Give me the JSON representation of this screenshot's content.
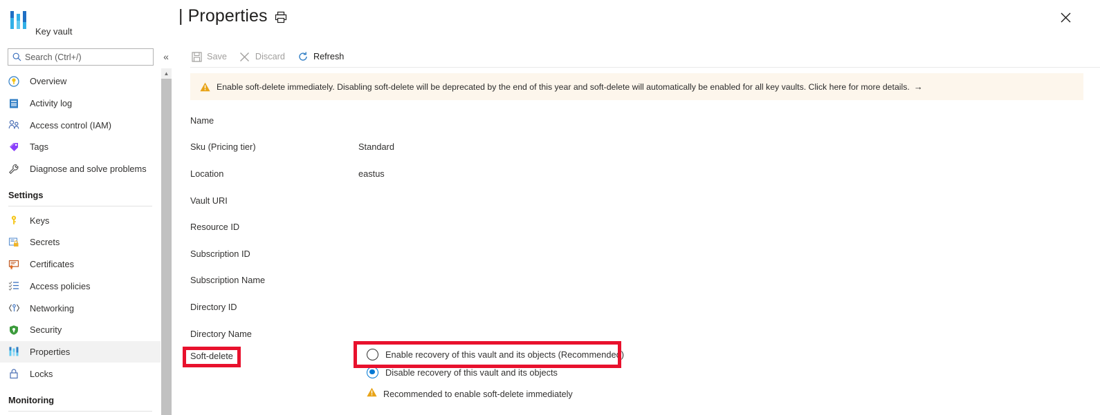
{
  "sidebar": {
    "resource_type": "Key vault",
    "logo_icon": "key-vault-icon",
    "search": {
      "placeholder": "Search (Ctrl+/)",
      "value": "",
      "icon": "search-icon"
    },
    "collapse_icon": "double-chevron-left-icon",
    "items": [
      {
        "label": "Overview",
        "icon": "overview-key-icon",
        "selected": false
      },
      {
        "label": "Activity log",
        "icon": "activity-log-icon",
        "selected": false
      },
      {
        "label": "Access control (IAM)",
        "icon": "access-control-people-icon",
        "selected": false
      },
      {
        "label": "Tags",
        "icon": "tags-icon",
        "selected": false
      },
      {
        "label": "Diagnose and solve problems",
        "icon": "diagnose-wrench-icon",
        "selected": false
      }
    ],
    "groups": [
      {
        "title": "Settings",
        "items": [
          {
            "label": "Keys",
            "icon": "key-icon",
            "selected": false
          },
          {
            "label": "Secrets",
            "icon": "secrets-lock-icon",
            "selected": false
          },
          {
            "label": "Certificates",
            "icon": "certificate-icon",
            "selected": false
          },
          {
            "label": "Access policies",
            "icon": "access-policies-list-icon",
            "selected": false
          },
          {
            "label": "Networking",
            "icon": "networking-icon",
            "selected": false
          },
          {
            "label": "Security",
            "icon": "security-shield-icon",
            "selected": false
          },
          {
            "label": "Properties",
            "icon": "properties-icon",
            "selected": true
          },
          {
            "label": "Locks",
            "icon": "locks-padlock-icon",
            "selected": false
          }
        ]
      },
      {
        "title": "Monitoring",
        "items": []
      }
    ]
  },
  "header": {
    "title": "| Properties",
    "print_icon": "printer-icon",
    "close_icon": "close-x-icon"
  },
  "toolbar": {
    "buttons": [
      {
        "label": "Save",
        "icon": "save-floppy-icon",
        "enabled": false
      },
      {
        "label": "Discard",
        "icon": "discard-x-icon",
        "enabled": false
      },
      {
        "label": "Refresh",
        "icon": "refresh-circular-arrow-icon",
        "enabled": true
      }
    ]
  },
  "banner": {
    "icon": "warning-triangle-icon",
    "text": "Enable soft-delete immediately. Disabling soft-delete will be deprecated by the end of this year and soft-delete will automatically be enabled for all key vaults. Click here for more details.",
    "arrow": "→",
    "background_color": "#fdf6ec",
    "icon_color": "#e8a317"
  },
  "properties": {
    "rows": [
      {
        "label": "Name",
        "value": ""
      },
      {
        "label": "Sku (Pricing tier)",
        "value": "Standard"
      },
      {
        "label": "Location",
        "value": "eastus"
      },
      {
        "label": "Vault URI",
        "value": ""
      },
      {
        "label": "Resource ID",
        "value": ""
      },
      {
        "label": "Subscription ID",
        "value": ""
      },
      {
        "label": "Subscription Name",
        "value": ""
      },
      {
        "label": "Directory ID",
        "value": ""
      },
      {
        "label": "Directory Name",
        "value": ""
      }
    ]
  },
  "soft_delete": {
    "label": "Soft-delete",
    "options": [
      {
        "label": "Enable recovery of this vault and its objects (Recommended)",
        "selected": false
      },
      {
        "label": "Disable recovery of this vault and its objects",
        "selected": true
      }
    ],
    "note": {
      "icon": "warning-triangle-icon",
      "text": "Recommended to enable soft-delete immediately"
    }
  },
  "annotations": {
    "color": "#e8112d",
    "boxes": [
      {
        "name": "soft-delete-label-highlight"
      },
      {
        "name": "enable-recovery-option-highlight"
      }
    ]
  },
  "scrollbar": {
    "up_arrow_icon": "scroll-up-arrow-icon"
  }
}
